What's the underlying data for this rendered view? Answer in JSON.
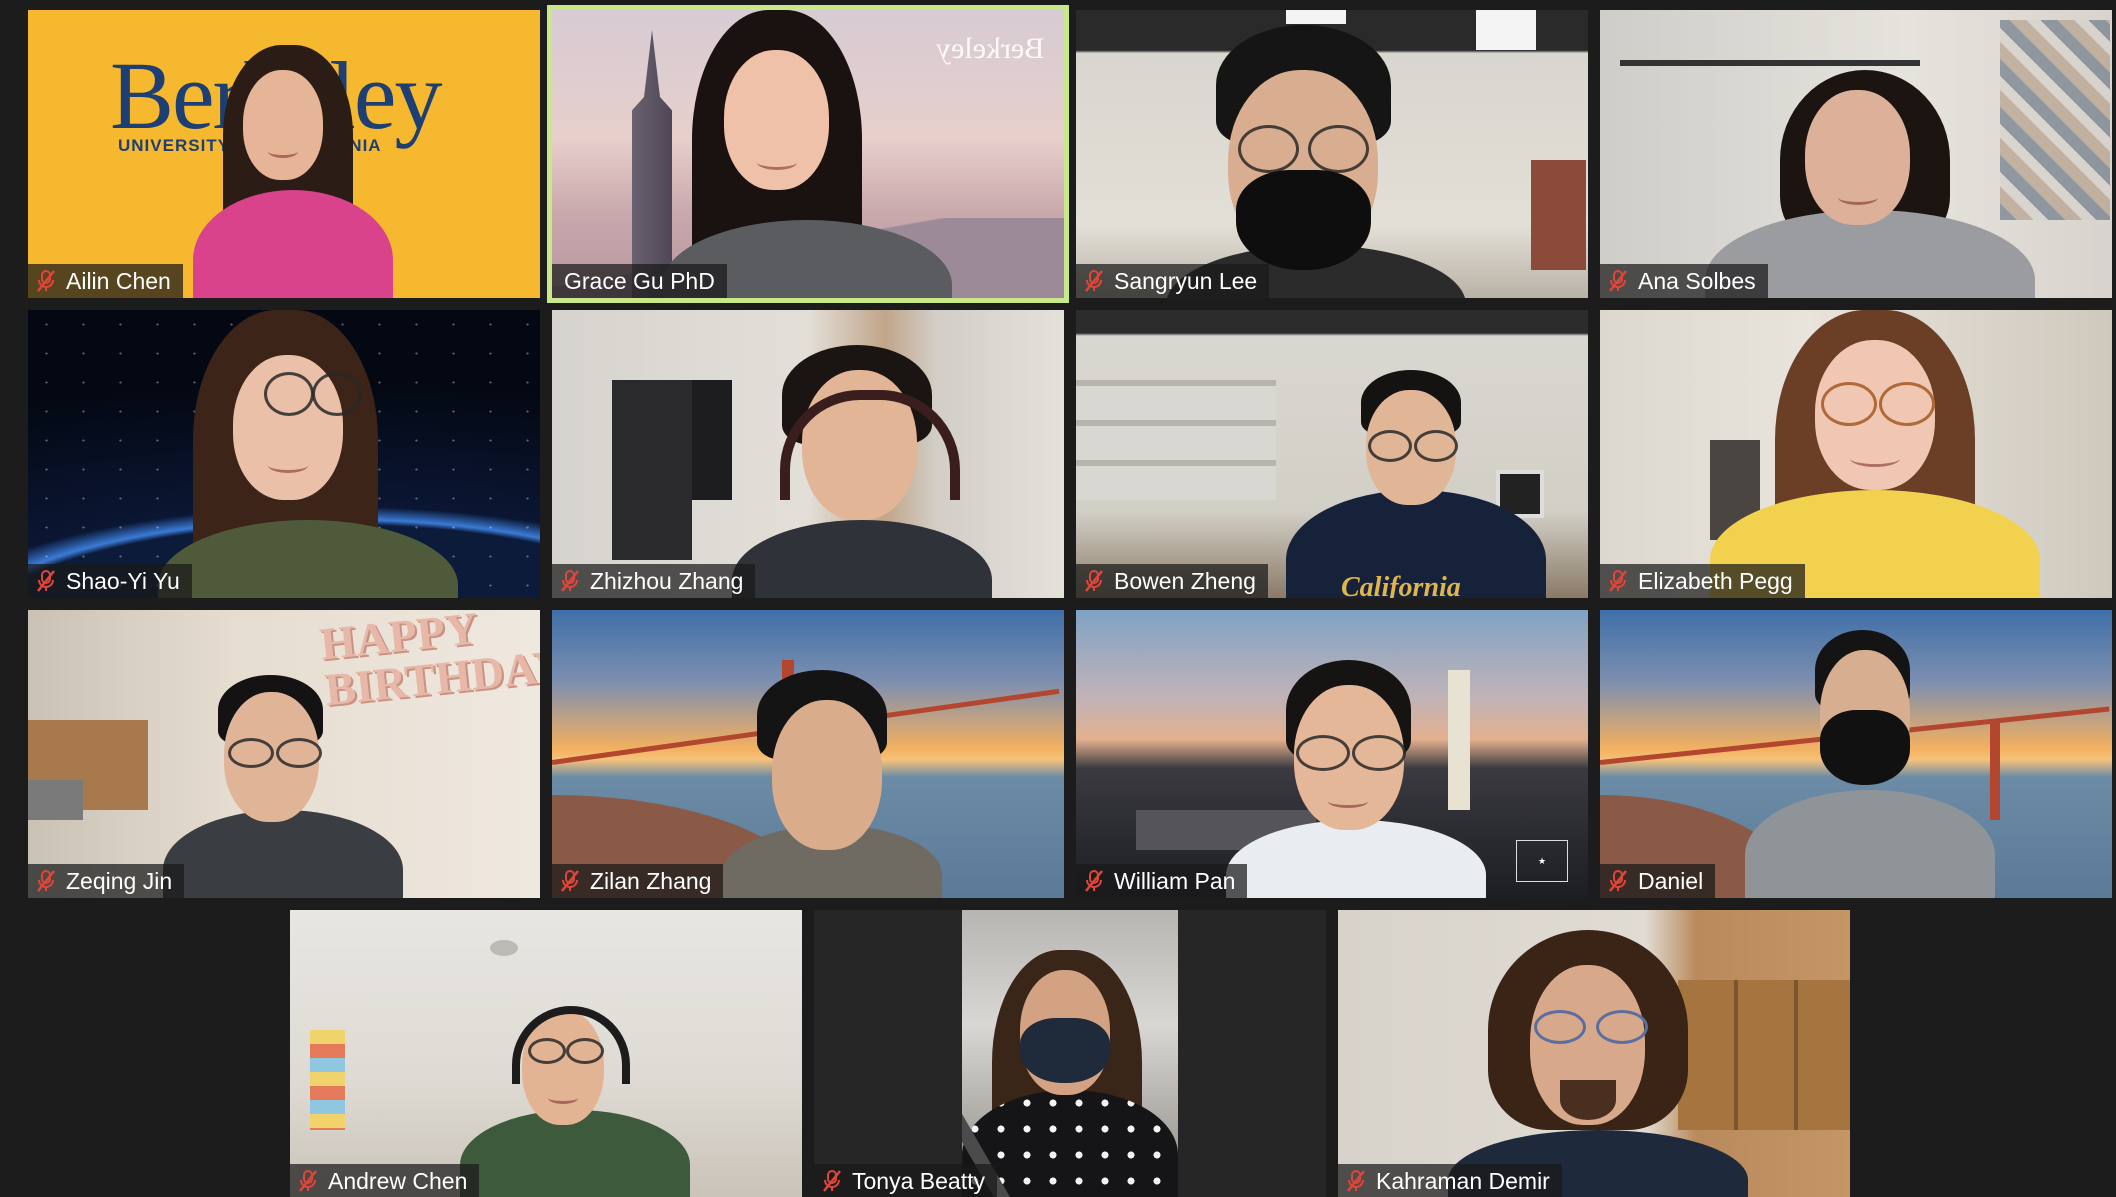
{
  "meeting": {
    "participants": [
      {
        "name": "Ailin Chen",
        "muted": true
      },
      {
        "name": "Grace Gu PhD",
        "muted": false,
        "active_speaker": true
      },
      {
        "name": "Sangryun Lee",
        "muted": true
      },
      {
        "name": "Ana Solbes",
        "muted": true
      },
      {
        "name": "Shao-Yi Yu",
        "muted": true
      },
      {
        "name": "Zhizhou Zhang",
        "muted": true
      },
      {
        "name": "Bowen Zheng",
        "muted": true
      },
      {
        "name": "Elizabeth Pegg",
        "muted": true
      },
      {
        "name": "Zeqing Jin",
        "muted": true
      },
      {
        "name": "Zilan Zhang",
        "muted": true
      },
      {
        "name": "William Pan",
        "muted": true
      },
      {
        "name": "Daniel",
        "muted": true
      },
      {
        "name": "Andrew Chen",
        "muted": true
      },
      {
        "name": "Tonya Beatty",
        "muted": true
      },
      {
        "name": "Kahraman Demir",
        "muted": true
      }
    ]
  },
  "backgrounds": {
    "berkeley_wordmark": "Berkeley",
    "berkeley_subtitle": "UNIVERSITY OF CALIFORNIA",
    "shirt_text": "California",
    "balloon_text": "HAPPY BIRTHDAY"
  },
  "colors": {
    "speaker_border": "#c8e88a",
    "muted_icon": "#e0453a",
    "berkeley_gold": "#f5b82e",
    "berkeley_blue": "#1d3f73"
  },
  "icons": {
    "muted": "microphone-muted-icon"
  }
}
